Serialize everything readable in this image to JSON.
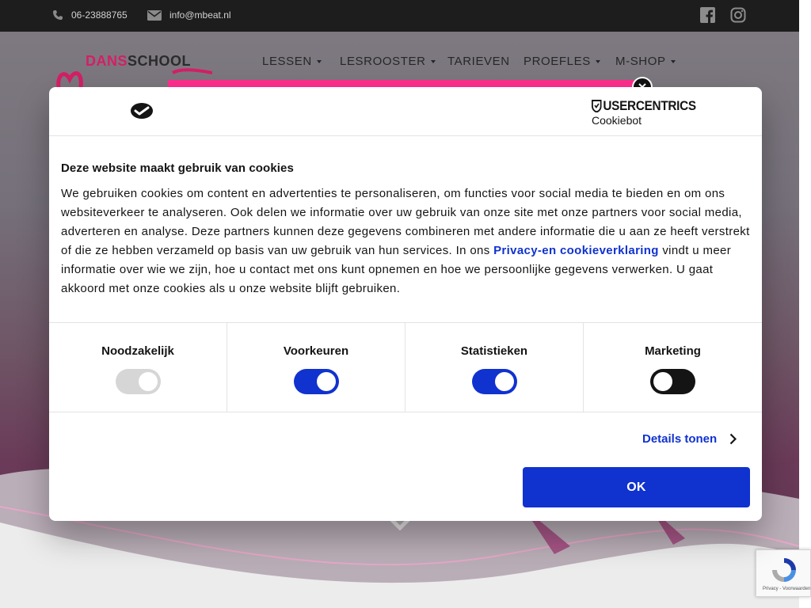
{
  "topbar": {
    "phone": "06-23888765",
    "email": "info@mbeat.nl",
    "social_icons": [
      "facebook-icon",
      "instagram-icon"
    ]
  },
  "site": {
    "logo_part1": "DANS",
    "logo_part2": "SCHOOL",
    "nav": [
      {
        "label": "LESSEN",
        "has_dropdown": true
      },
      {
        "label": "LESROOSTER",
        "has_dropdown": true
      },
      {
        "label": "TARIEVEN",
        "has_dropdown": false
      },
      {
        "label": "PROEFLES",
        "has_dropdown": true
      },
      {
        "label": "M-SHOP",
        "has_dropdown": true
      }
    ]
  },
  "dialog": {
    "brand_name": "USERCENTRICS",
    "brand_sub": "Cookiebot",
    "title": "Deze website maakt gebruik van cookies",
    "text_before_link": "We gebruiken cookies om content en advertenties te personaliseren, om functies voor social media te bieden en om ons websiteverkeer te analyseren. Ook delen we informatie over uw gebruik van onze site met onze partners voor social media, adverteren en analyse. Deze partners kunnen deze gegevens combineren met andere informatie die u aan ze heeft verstrekt of die ze hebben verzameld op basis van uw gebruik van hun services. In ons ",
    "link_text": "Privacy-en cookieverklaring",
    "text_after_link": " vindt u meer informatie over wie we zijn, hoe u contact met ons kunt opnemen en hoe we persoonlijke gegevens verwerken. U gaat akkoord met onze cookies als u onze website blijft gebruiken.",
    "categories": [
      {
        "label": "Noodzakelijk",
        "state": "on",
        "disabled": true
      },
      {
        "label": "Voorkeuren",
        "state": "on",
        "disabled": false
      },
      {
        "label": "Statistieken",
        "state": "on",
        "disabled": false
      },
      {
        "label": "Marketing",
        "state": "off",
        "disabled": false
      }
    ],
    "details_label": "Details tonen",
    "ok_label": "OK"
  },
  "recaptcha": {
    "footer": "Privacy - Voorwaarden"
  },
  "colors": {
    "accent_blue": "#1032cf",
    "brand_pink": "#d41f66",
    "banner_pink": "#ff2f8e",
    "topbar_bg": "#1d1d1d"
  }
}
